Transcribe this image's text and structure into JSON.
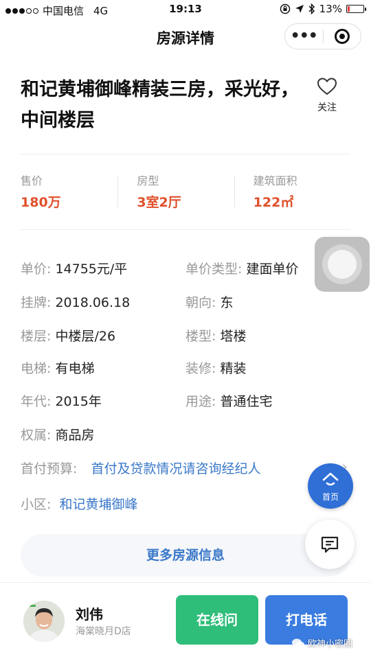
{
  "status_bar": {
    "carrier": "中国电信",
    "network": "4G",
    "time": "19:13",
    "battery": "13%"
  },
  "nav": {
    "title": "房源详情",
    "more_icon": "ellipsis-icon",
    "close_icon": "target-icon"
  },
  "listing": {
    "title": "和记黄埔御峰精装三房，采光好，中间楼层",
    "follow_label": "关注"
  },
  "stats": [
    {
      "label": "售价",
      "value": "180万"
    },
    {
      "label": "房型",
      "value": "3室2厅"
    },
    {
      "label": "建筑面积",
      "value": "122㎡"
    }
  ],
  "details": {
    "unit_price": {
      "label": "单价:",
      "value": "14755元/平"
    },
    "unit_price_type": {
      "label": "单价类型:",
      "value": "建面单价"
    },
    "listed": {
      "label": "挂牌:",
      "value": "2018.06.18"
    },
    "orientation": {
      "label": "朝向:",
      "value": "东"
    },
    "floor": {
      "label": "楼层:",
      "value": "中楼层/26"
    },
    "building_type": {
      "label": "楼型:",
      "value": "塔楼"
    },
    "elevator": {
      "label": "电梯:",
      "value": "有电梯"
    },
    "decoration": {
      "label": "装修:",
      "value": "精装"
    },
    "year": {
      "label": "年代:",
      "value": "2015年"
    },
    "usage": {
      "label": "用途:",
      "value": "普通住宅"
    },
    "ownership": {
      "label": "权属:",
      "value": "商品房"
    },
    "down_payment": {
      "label": "首付预算:",
      "value": "首付及贷款情况请咨询经纪人"
    },
    "community": {
      "label": "小区:",
      "value": "和记黄埔御峰"
    }
  },
  "more_button": "更多房源信息",
  "home_fab": "首页",
  "agent": {
    "name": "刘伟",
    "store": "海棠晓月D店"
  },
  "actions": {
    "online": "在线问",
    "call": "打电话"
  },
  "watermark": "欧神小密圈",
  "colors": {
    "price_red": "#e0502b",
    "link_blue": "#3a78c9",
    "green_button": "#2fbd7a",
    "blue_button": "#3a7ce0"
  }
}
